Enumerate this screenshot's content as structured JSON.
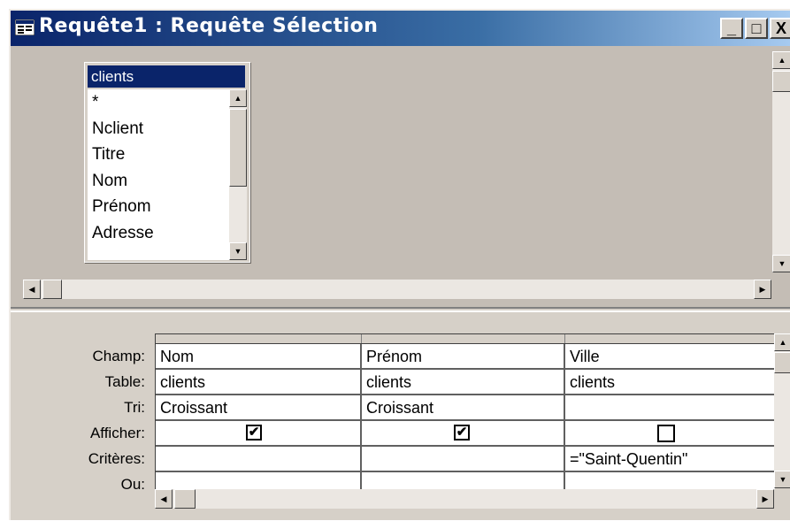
{
  "window": {
    "title": "Requête1 : Requête Sélection",
    "controls": {
      "minimize": "_",
      "maximize": "□",
      "close": "X"
    }
  },
  "table_box": {
    "title": "clients",
    "fields": [
      "*",
      "Nclient",
      "Titre",
      "Nom",
      "Prénom",
      "Adresse"
    ]
  },
  "grid": {
    "row_labels": [
      "Champ:",
      "Table:",
      "Tri:",
      "Afficher:",
      "Critères:",
      "Ou:"
    ],
    "columns": [
      {
        "champ": "Nom",
        "table": "clients",
        "tri": "Croissant",
        "afficher": true,
        "criteres": "",
        "ou": ""
      },
      {
        "champ": "Prénom",
        "table": "clients",
        "tri": "Croissant",
        "afficher": true,
        "criteres": "",
        "ou": ""
      },
      {
        "champ": "Ville",
        "table": "clients",
        "tri": "",
        "afficher": false,
        "criteres": "=\"Saint-Quentin\"",
        "ou": ""
      }
    ]
  },
  "icons": {
    "check": "✔",
    "arrow_up": "▲",
    "arrow_down": "▼",
    "arrow_left": "◀",
    "arrow_right": "▶"
  },
  "colors": {
    "title_gradient_start": "#0a246a",
    "title_gradient_end": "#a6caf0",
    "face": "#d6d0c8",
    "workspace": "#c4bdb5"
  }
}
